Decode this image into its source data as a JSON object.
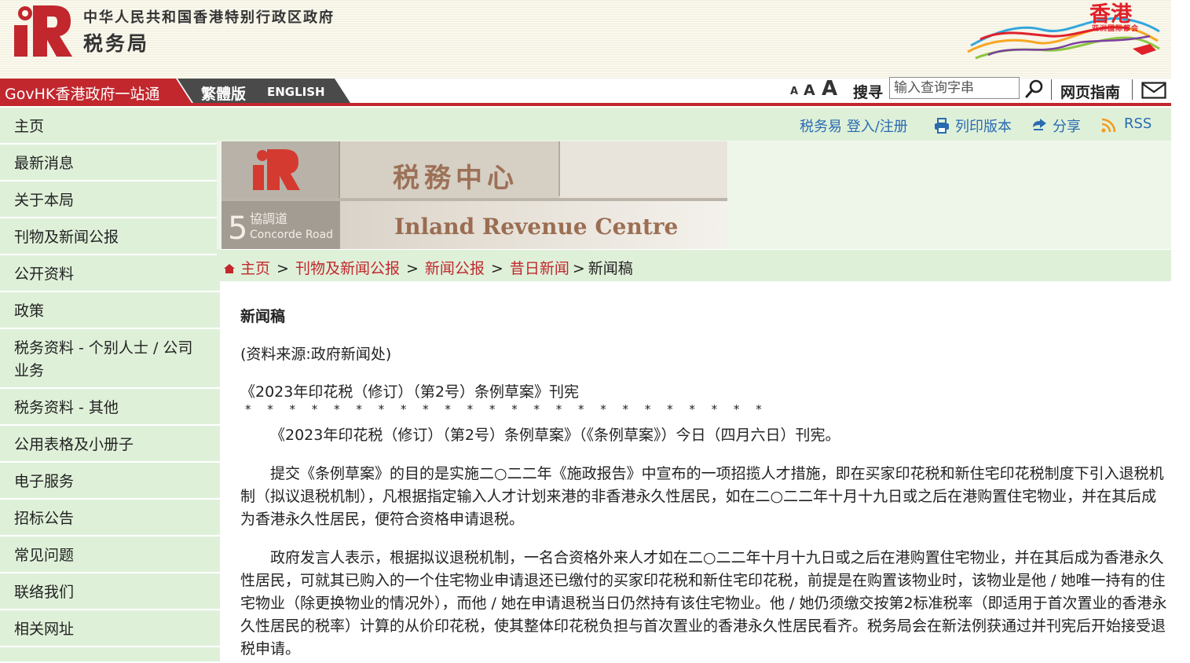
{
  "header": {
    "gov_name": "中华人民共和国香港特别行政区政府",
    "dept_name": "税务局",
    "brand_title": "香港",
    "brand_subtitle": "亚洲国际都会",
    "brand_color": "#e0202a",
    "ird_red": "#c1272d"
  },
  "topbar": {
    "govhk_label": "GovHK香港政府一站通",
    "lang_traditional": "繁體版",
    "lang_english": "ENGLISH",
    "font_small": "A",
    "font_medium": "A",
    "font_large": "A",
    "search_label": "搜寻",
    "search_placeholder": "输入查询字串",
    "site_guide": "网页指南"
  },
  "sidebar": {
    "items": [
      {
        "label": "主页"
      },
      {
        "label": "最新消息"
      },
      {
        "label": "关于本局"
      },
      {
        "label": "刊物及新闻公报"
      },
      {
        "label": "公开资料"
      },
      {
        "label": "政策"
      },
      {
        "label": "税务资料 - 个别人士 / 公司业务"
      },
      {
        "label": "税务资料 - 其他"
      },
      {
        "label": "公用表格及小册子"
      },
      {
        "label": "电子服务"
      },
      {
        "label": "招标公告"
      },
      {
        "label": "常见问题"
      },
      {
        "label": "联络我们"
      },
      {
        "label": "相关网址"
      }
    ],
    "background_color": "#dff0d9"
  },
  "utility": {
    "etax_login": "税务易 登入/注册",
    "print_version": "列印版本",
    "share": "分享",
    "rss": "RSS",
    "link_color": "#2a6bb0"
  },
  "banner": {
    "sign_chinese": "税務中心",
    "sign_english": "Inland Revenue Centre",
    "road_number": "5",
    "road_chinese": "協調道",
    "road_english": "Concorde Road"
  },
  "breadcrumb": {
    "home": "主页",
    "publications": "刊物及新闻公报",
    "press_releases": "新闻公报",
    "past_news": "昔日新闻",
    "current": "新闻稿",
    "sep": ">"
  },
  "article": {
    "title": "新闻稿",
    "source": "(资料来源:政府新闻处)",
    "heading": "《2023年印花税（修订）（第2号）条例草案》刊宪",
    "stars": "* * * * * * * * * * * * * * * * * * * * * * * *",
    "paragraphs": [
      "《2023年印花税（修订）（第2号）条例草案》（《条例草案》）今日（四月六日）刊宪。",
      "提交《条例草案》的目的是实施二○二二年《施政报告》中宣布的一项招揽人才措施，即在买家印花税和新住宅印花税制度下引入退税机制（拟议退税机制），凡根据指定输入人才计划来港的非香港永久性居民，如在二○二二年十月十九日或之后在港购置住宅物业，并在其后成为香港永久性居民，便符合资格申请退税。",
      "政府发言人表示，根据拟议退税机制，一名合资格外来人才如在二○二二年十月十九日或之后在港购置住宅物业，并在其后成为香港永久性居民，可就其已购入的一个住宅物业申请退还已缴付的买家印花税和新住宅印花税，前提是在购置该物业时，该物业是他 / 她唯一持有的住宅物业（除更换物业的情况外），而他 / 她在申请退税当日仍然持有该住宅物业。他 / 她仍须缴交按第2标准税率（即适用于首次置业的香港永久性居民的税率）计算的从价印花税，使其整体印花税负担与首次置业的香港永久性居民看齐。税务局会在新法例获通过并刊宪后开始接受退税申请。"
    ]
  }
}
